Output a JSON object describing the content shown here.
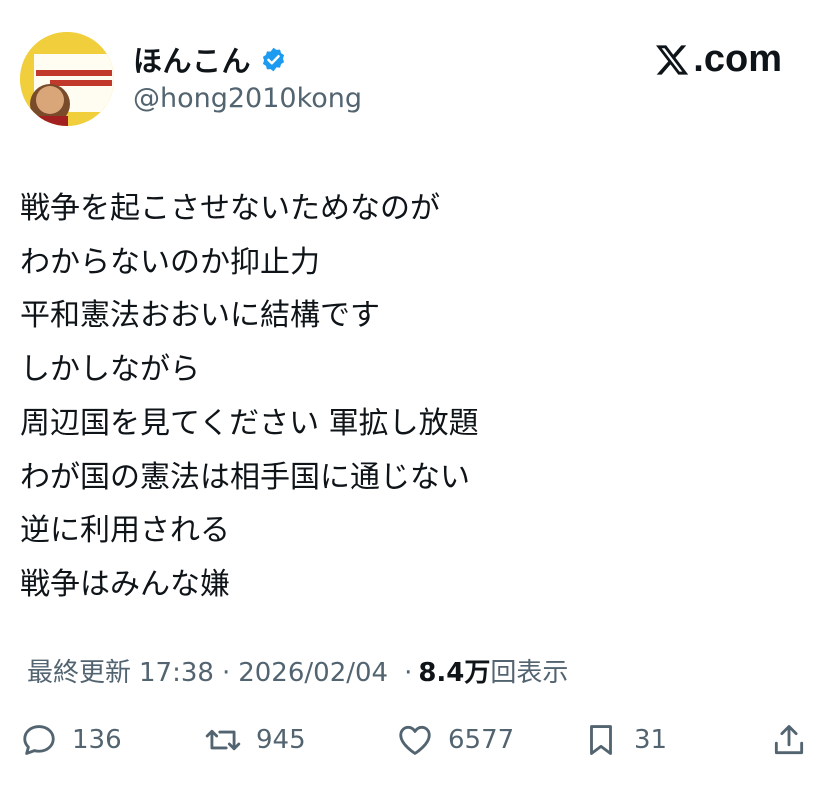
{
  "header": {
    "display_name": "ほんこん",
    "handle": "@hong2010kong",
    "brand_label": ".com",
    "verified_icon": "verified-badge-icon"
  },
  "tweet": {
    "lines": [
      "戦争を起こさせないためなのが",
      "わからないのか抑止力",
      "平和憲法おおいに結構です",
      "しかしながら",
      "周辺国を見てください 軍拡し放題",
      "わが国の憲法は相手国に通じない",
      "逆に利用される",
      "戦争はみんな嫌"
    ]
  },
  "meta": {
    "updated_label": "最終更新",
    "time": "17:38",
    "separator": "·",
    "date": "2026/02/04",
    "views_separator": "·",
    "views_count": "8.4万",
    "views_label": "回表示"
  },
  "actions": {
    "replies": "136",
    "reposts": "945",
    "likes": "6577",
    "bookmarks": "31"
  },
  "colors": {
    "text": "#0f1419",
    "secondary": "#536471",
    "verified": "#1d9bf0"
  }
}
